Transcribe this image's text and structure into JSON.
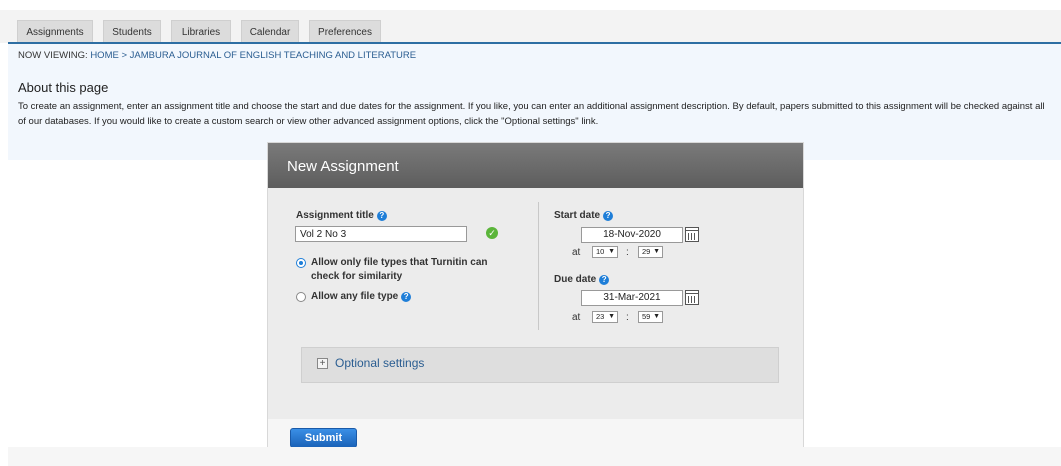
{
  "tabs": [
    {
      "label": "Assignments"
    },
    {
      "label": "Students"
    },
    {
      "label": "Libraries"
    },
    {
      "label": "Calendar"
    },
    {
      "label": "Preferences"
    }
  ],
  "breadcrumb": {
    "prefix": "NOW VIEWING: ",
    "home": "HOME",
    "separator": " > ",
    "current": "JAMBURA JOURNAL OF ENGLISH TEACHING AND LITERATURE"
  },
  "about": {
    "title": "About this page",
    "text": "To create an assignment, enter an assignment title and choose the start and due dates for the assignment. If you like, you can enter an additional assignment description. By default, papers submitted to this assignment will be checked against all of our databases. If you would like to create a custom search or view other advanced assignment options, click the \"Optional settings\" link."
  },
  "form": {
    "header": "New Assignment",
    "title_label": "Assignment title",
    "title_value": "Vol 2 No 3",
    "radio_restricted": "Allow only file types that Turnitin can check for similarity",
    "radio_any": "Allow any file type",
    "start_label": "Start date",
    "start_date": "18-Nov-2020",
    "start_hour": "10",
    "start_minute": "29",
    "due_label": "Due date",
    "due_date": "31-Mar-2021",
    "due_hour": "23",
    "due_minute": "59",
    "at_label": "at",
    "colon": ":",
    "optional_label": "Optional settings",
    "submit_label": "Submit"
  },
  "icons": {
    "help": "question-icon",
    "check": "check-icon",
    "calendar": "calendar-icon",
    "expand": "plus-icon"
  },
  "colors": {
    "accent": "#2d6ea3",
    "link": "#2a5d91",
    "help": "#1e7ed8",
    "success": "#5bb53a",
    "submit": "#1a62b8"
  }
}
